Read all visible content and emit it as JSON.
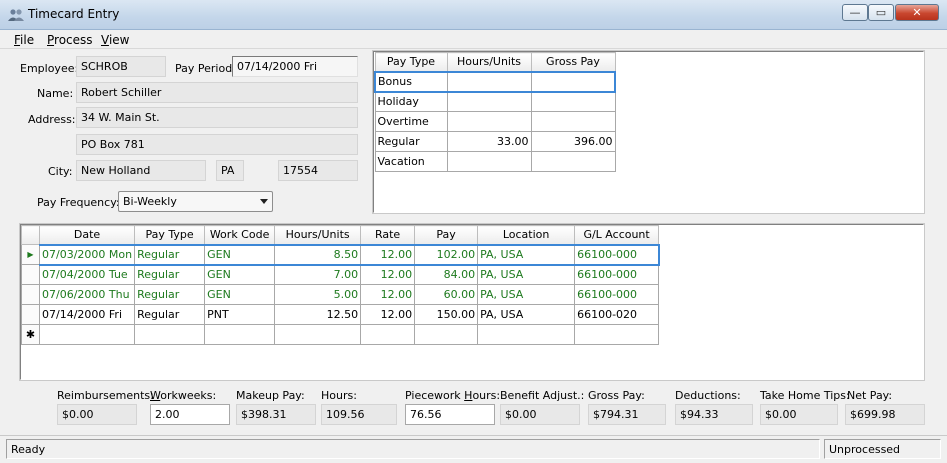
{
  "window": {
    "title": "Timecard Entry",
    "min_label": "—",
    "max_label": "▭",
    "close_label": "✕"
  },
  "menu": [
    {
      "key": "F",
      "rest": "ile"
    },
    {
      "key": "P",
      "rest": "rocess"
    },
    {
      "key": "V",
      "rest": "iew"
    }
  ],
  "employee": {
    "employee_label": "Employee:",
    "employee_value": "SCHROB",
    "pay_period_label": "Pay Period:",
    "pay_period_value": "07/14/2000 Fri",
    "name_label": "Name:",
    "name_value": "Robert Schiller",
    "address_label": "Address:",
    "address1": "34 W. Main St.",
    "address2": "PO Box 781",
    "city_label": "City:",
    "city_value": "New Holland",
    "state_value": "PA",
    "zip_value": "17554",
    "pay_freq_label": "Pay Frequency:",
    "pay_freq_value": "Bi-Weekly"
  },
  "paytype_grid": {
    "headers": [
      "Pay Type",
      "Hours/Units",
      "Gross Pay"
    ],
    "rows": [
      [
        "Bonus",
        "",
        ""
      ],
      [
        "Holiday",
        "",
        ""
      ],
      [
        "Overtime",
        "",
        ""
      ],
      [
        "Regular",
        "33.00",
        "396.00"
      ],
      [
        "Vacation",
        "",
        ""
      ]
    ]
  },
  "detail_grid": {
    "headers": [
      "Date",
      "Pay Type",
      "Work Code",
      "Hours/Units",
      "Rate",
      "Pay",
      "Location",
      "G/L Account"
    ],
    "rows": [
      [
        "07/03/2000 Mon",
        "Regular",
        "GEN",
        "8.50",
        "12.00",
        "102.00",
        "PA, USA",
        "66100-000"
      ],
      [
        "07/04/2000 Tue",
        "Regular",
        "GEN",
        "7.00",
        "12.00",
        "84.00",
        "PA, USA",
        "66100-000"
      ],
      [
        "07/06/2000 Thu",
        "Regular",
        "GEN",
        "5.00",
        "12.00",
        "60.00",
        "PA, USA",
        "66100-000"
      ],
      [
        "07/14/2000 Fri",
        "Regular",
        "PNT",
        "12.50",
        "12.00",
        "150.00",
        "PA, USA",
        "66100-020"
      ]
    ],
    "current_row_marker": "▶",
    "new_row_marker": "✱"
  },
  "totals": {
    "reimb_label": "Reimbursements:",
    "reimb_value": "$0.00",
    "workweeks_label": "Workweeks:",
    "workweeks_value": "2.00",
    "makeup_label": "Makeup Pay:",
    "makeup_value": "$398.31",
    "hours_label": "Hours:",
    "hours_value": "109.56",
    "piecework_label": "Piecework Hours:",
    "piecework_value": "76.56",
    "benefit_label": "Benefit Adjust.:",
    "benefit_value": "$0.00",
    "gross_label": "Gross Pay:",
    "gross_value": "$794.31",
    "deductions_label": "Deductions:",
    "deductions_value": "$94.33",
    "tips_label": "Take Home Tips:",
    "tips_value": "$0.00",
    "net_label": "Net Pay:",
    "net_value": "$699.98"
  },
  "status": {
    "left": "Ready",
    "right": "Unprocessed"
  },
  "colors": {
    "green_text": "#1e7a1e",
    "selection_border": "#3c87d6"
  }
}
